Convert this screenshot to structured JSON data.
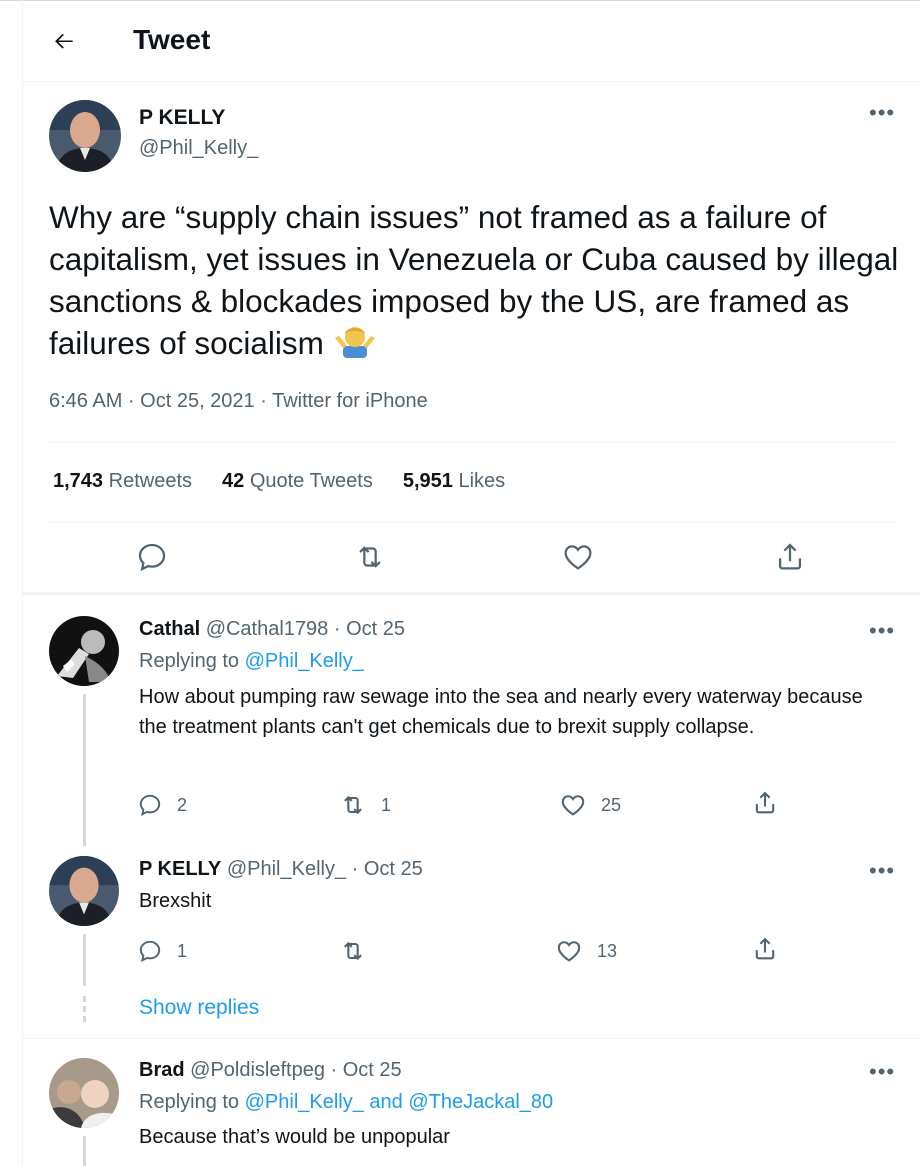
{
  "header": {
    "title": "Tweet"
  },
  "main_tweet": {
    "name": "P KELLY",
    "handle": "@Phil_Kelly_",
    "text": "Why are “supply chain issues” not framed as a failure of capitalism, yet issues in Venezuela or Cuba caused by illegal sanctions & blockades imposed by the US, are framed as failures of socialism",
    "emoji": "man-shrugging-emoji",
    "meta": "6:46 AM · Oct 25, 2021 · Twitter for iPhone",
    "stats": {
      "retweets_count": "1,743",
      "retweets_label": "Retweets",
      "quotes_count": "42",
      "quotes_label": "Quote Tweets",
      "likes_count": "5,951",
      "likes_label": "Likes"
    }
  },
  "replies": [
    {
      "name": "Cathal",
      "handle": "@Cathal1798",
      "date": "· Oct 25",
      "replying_prefix": "Replying to",
      "replying_to": "@Phil_Kelly_",
      "text": "How about pumping raw sewage into the sea and nearly every waterway because the treatment plants can't get chemicals due to brexit supply collapse.",
      "reply_count": "2",
      "retweet_count": "1",
      "like_count": "25"
    },
    {
      "name": "P KELLY",
      "handle": "@Phil_Kelly_",
      "date": "· Oct 25",
      "text": "Brexshit",
      "reply_count": "1",
      "retweet_count": "",
      "like_count": "13"
    },
    {
      "name": "Brad",
      "handle": "@Poldisleftpeg",
      "date": "· Oct 25",
      "replying_prefix": "Replying to",
      "replying_to": "@Phil_Kelly_ and @TheJackal_80",
      "text": "Because that’s would be unpopular"
    }
  ],
  "show_replies": "Show replies",
  "colors": {
    "accent": "#1d9bf0",
    "secondary_text": "#536471",
    "primary_text": "#0f1419"
  }
}
